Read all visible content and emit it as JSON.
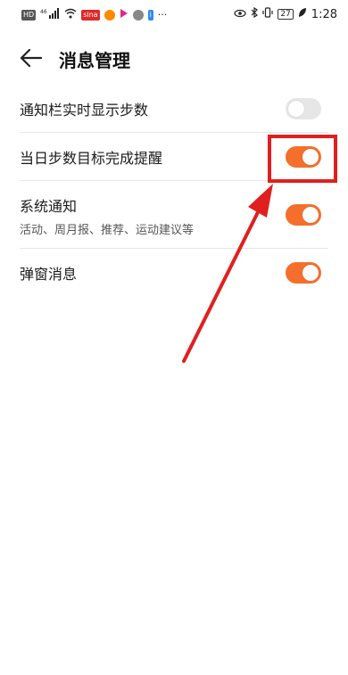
{
  "statusbar": {
    "left_chips": [
      "HD",
      "46",
      "sina",
      "weibo",
      "play",
      "qq",
      "info",
      "..."
    ],
    "time": "1:28",
    "battery": "27"
  },
  "header": {
    "title": "消息管理"
  },
  "settings": [
    {
      "label": "通知栏实时显示步数",
      "sub": "",
      "toggle": "off"
    },
    {
      "label": "当日步数目标完成提醒",
      "sub": "",
      "toggle": "on"
    },
    {
      "label": "系统通知",
      "sub": "活动、周月报、推荐、运动建议等",
      "toggle": "on"
    },
    {
      "label": "弹窗消息",
      "sub": "",
      "toggle": "on"
    }
  ],
  "colors": {
    "toggle_on": "#f56f2c",
    "toggle_off": "#e6e6e6",
    "annotation": "#e0201e"
  }
}
